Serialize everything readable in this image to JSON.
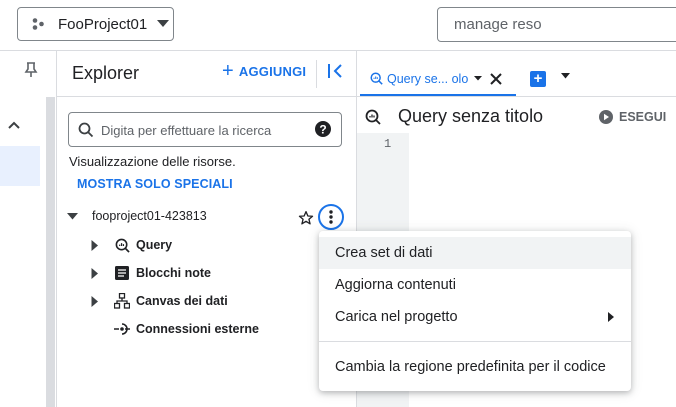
{
  "topbar": {
    "project_name": "FooProject01",
    "search_value": "manage reso"
  },
  "explorer": {
    "title": "Explorer",
    "add_label": "AGGIUNGI",
    "search_placeholder": "Digita per effettuare la ricerca",
    "resource_text": "Visualizzazione delle risorse.",
    "show_starred": "MOSTRA SOLO SPECIALI",
    "project": "fooproject01-423813",
    "children": [
      {
        "label": "Query",
        "icon": "query-icon"
      },
      {
        "label": "Blocchi note",
        "icon": "notebook-icon"
      },
      {
        "label": "Canvas dei dati",
        "icon": "canvas-icon"
      },
      {
        "label": "Connessioni esterne",
        "icon": "connection-icon"
      }
    ]
  },
  "editor": {
    "tab_label": "Query se... olo",
    "title": "Query senza titolo",
    "run_label": "ESEGUI",
    "line_number": "1"
  },
  "menu": {
    "items": [
      "Crea set di dati",
      "Aggiorna contenuti",
      "Carica nel progetto",
      "Cambia la regione predefinita per il codice"
    ]
  },
  "colors": {
    "accent": "#1a73e8",
    "hover": "#f1f3f4",
    "border": "#dadce0"
  }
}
